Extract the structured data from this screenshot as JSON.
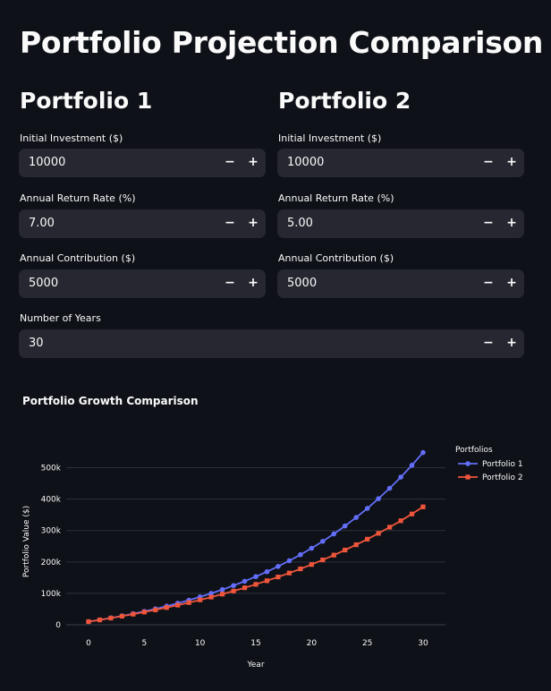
{
  "page_title": "Portfolio Projection Comparison",
  "portfolio1": {
    "title": "Portfolio 1",
    "initial_label": "Initial Investment ($)",
    "initial_value": "10000",
    "rate_label": "Annual Return Rate (%)",
    "rate_value": "7.00",
    "contribution_label": "Annual Contribution ($)",
    "contribution_value": "5000"
  },
  "portfolio2": {
    "title": "Portfolio 2",
    "initial_label": "Initial Investment ($)",
    "initial_value": "10000",
    "rate_label": "Annual Return Rate (%)",
    "rate_value": "5.00",
    "contribution_label": "Annual Contribution ($)",
    "contribution_value": "5000"
  },
  "years": {
    "label": "Number of Years",
    "value": "30"
  },
  "stepper": {
    "minus": "−",
    "plus": "+"
  },
  "chart_title": "Portfolio Growth Comparison",
  "chart_data": {
    "type": "line",
    "title": "Portfolio Growth Comparison",
    "xlabel": "Year",
    "ylabel": "Portfolio Value ($)",
    "xlim": [
      0,
      30
    ],
    "ylim": [
      0,
      550000
    ],
    "x_ticks": [
      0,
      5,
      10,
      15,
      20,
      25,
      30
    ],
    "y_ticks": [
      0,
      100000,
      200000,
      300000,
      400000,
      500000
    ],
    "y_tick_labels": [
      "0",
      "100k",
      "200k",
      "300k",
      "400k",
      "500k"
    ],
    "grid": true,
    "legend_title": "Portfolios",
    "legend_position": "top-right",
    "x": [
      0,
      1,
      2,
      3,
      4,
      5,
      6,
      7,
      8,
      9,
      10,
      11,
      12,
      13,
      14,
      15,
      16,
      17,
      18,
      19,
      20,
      21,
      22,
      23,
      24,
      25,
      26,
      27,
      28,
      29,
      30
    ],
    "series": [
      {
        "name": "Portfolio 1",
        "color": "#636efa",
        "marker": "circle",
        "values": [
          10000,
          15700,
          21799,
          28325,
          35308,
          42780,
          50775,
          59329,
          68482,
          78276,
          88755,
          99968,
          111966,
          124804,
          138540,
          153238,
          168965,
          185792,
          203798,
          223064,
          243679,
          265737,
          289338,
          314592,
          341613,
          370526,
          401462,
          434565,
          469985,
          507884,
          548436
        ]
      },
      {
        "name": "Portfolio 2",
        "color": "#ef553b",
        "marker": "square",
        "values": [
          10000,
          15500,
          21275,
          27339,
          33706,
          40391,
          47411,
          54781,
          62520,
          70646,
          79178,
          88137,
          97544,
          107421,
          117792,
          128682,
          140116,
          152122,
          164728,
          177964,
          191863,
          206456,
          221779,
          237868,
          254761,
          272499,
          291124,
          310680,
          331214,
          352775,
          375414
        ]
      }
    ]
  }
}
